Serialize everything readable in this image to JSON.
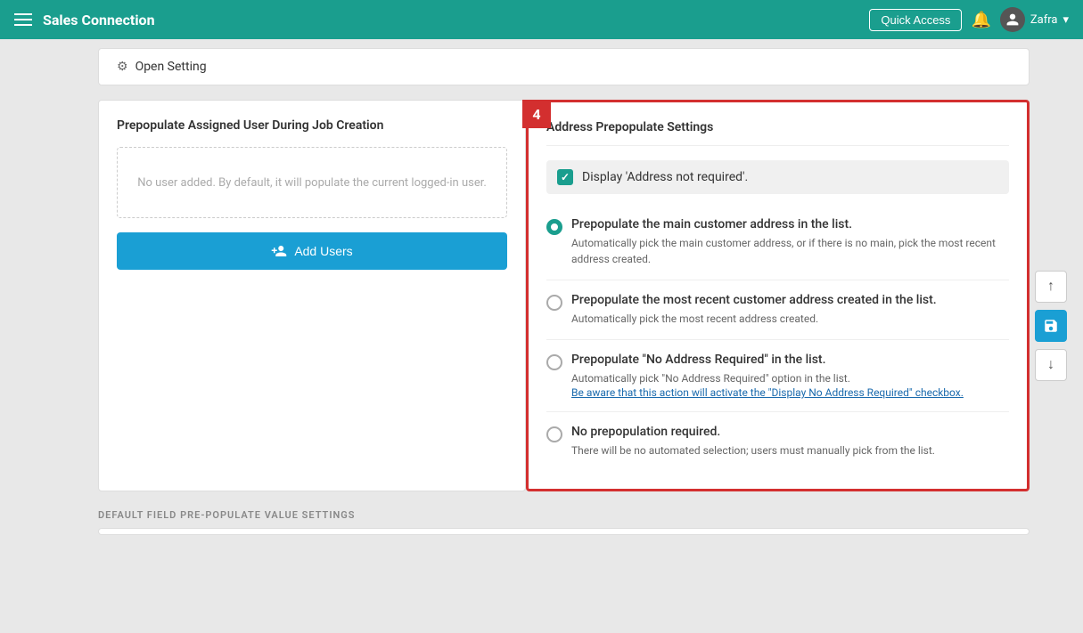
{
  "header": {
    "app_name": "Sales Connection",
    "quick_access_label": "Quick Access",
    "user_name": "Zafra",
    "bell_icon": "bell",
    "hamburger_icon": "menu",
    "chevron_icon": "chevron-down"
  },
  "open_setting": {
    "label": "Open Setting",
    "gear_icon": "gear"
  },
  "left_panel": {
    "title": "Prepopulate Assigned User During Job Creation",
    "no_user_text": "No user added. By default, it will populate the current logged-in user.",
    "add_users_label": "Add Users",
    "add_users_icon": "person-add"
  },
  "step_badge": "4",
  "right_panel": {
    "title": "Address Prepopulate Settings",
    "checkbox": {
      "label": "Display 'Address not required'.",
      "checked": true
    },
    "radio_options": [
      {
        "id": "opt1",
        "label": "Prepopulate the main customer address in the list.",
        "desc": "Automatically pick the main customer address, or if there is no main, pick the most recent address created.",
        "selected": true,
        "link": null
      },
      {
        "id": "opt2",
        "label": "Prepopulate the most recent customer address created in the list.",
        "desc": "Automatically pick the most recent address created.",
        "selected": false,
        "link": null
      },
      {
        "id": "opt3",
        "label": "Prepopulate \"No Address Required\" in the list.",
        "desc": "Automatically pick \"No Address Required\" option in the list.",
        "selected": false,
        "link": "Be aware that this action will activate the \"Display No Address Required\" checkbox.",
        "extra_desc": null
      },
      {
        "id": "opt4",
        "label": "No prepopulation required.",
        "desc": "There will be no automated selection; users must manually pick from the list.",
        "selected": false,
        "link": null
      }
    ]
  },
  "side_actions": {
    "up_label": "↑",
    "save_label": "💾",
    "down_label": "↓"
  },
  "default_field_section": {
    "label": "DEFAULT FIELD PRE-POPULATE VALUE SETTINGS"
  }
}
